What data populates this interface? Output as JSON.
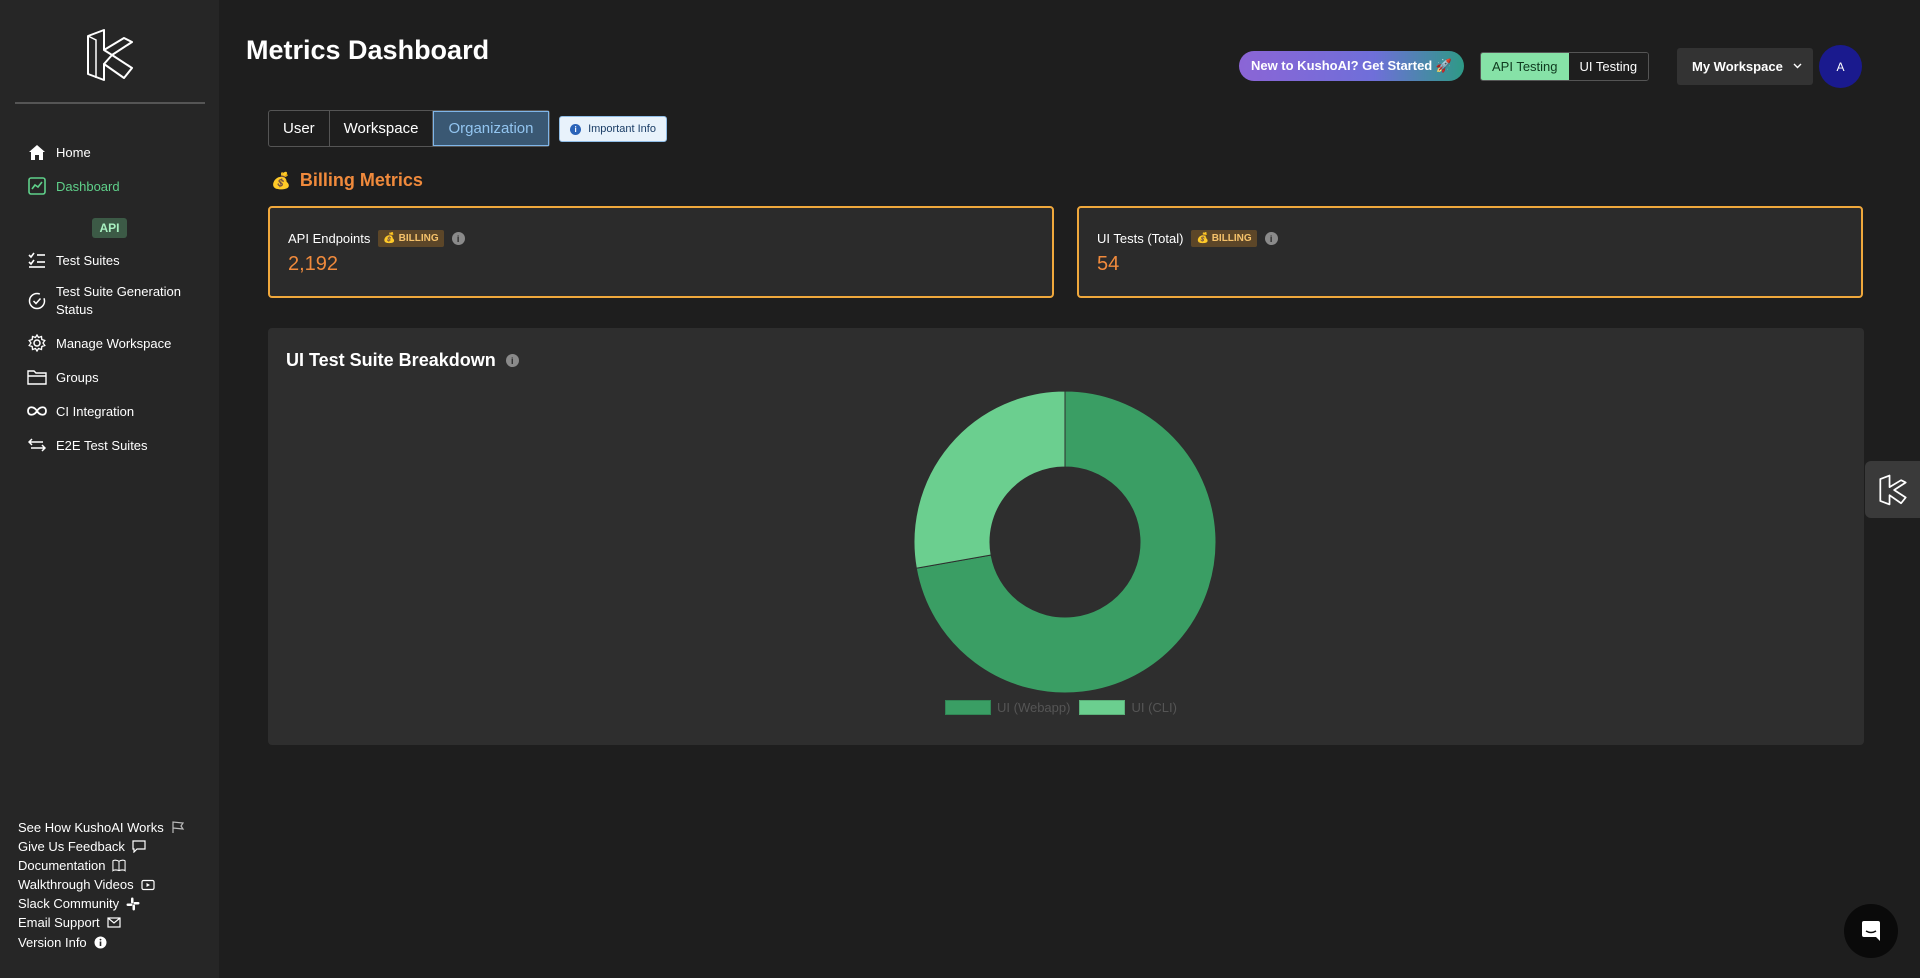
{
  "sidebar": {
    "nav": [
      {
        "label": "Home",
        "icon": "home-icon"
      },
      {
        "label": "Dashboard",
        "icon": "chart-icon",
        "active": true
      },
      {
        "label": "Test Suites",
        "icon": "checklist-icon"
      },
      {
        "label": "Test Suite Generation Status",
        "icon": "check-circle-icon"
      },
      {
        "label": "Manage Workspace",
        "icon": "gear-icon"
      },
      {
        "label": "Groups",
        "icon": "folder-icon"
      },
      {
        "label": "CI Integration",
        "icon": "infinity-icon"
      },
      {
        "label": "E2E Test Suites",
        "icon": "swap-icon"
      }
    ],
    "api_badge": "API",
    "footer": [
      {
        "label": "See How KushoAI Works",
        "icon": "flag-icon"
      },
      {
        "label": "Give Us Feedback",
        "icon": "feedback-icon"
      },
      {
        "label": "Documentation",
        "icon": "book-icon"
      },
      {
        "label": "Walkthrough Videos",
        "icon": "video-icon"
      },
      {
        "label": "Slack Community",
        "icon": "slack-icon"
      },
      {
        "label": "Email Support",
        "icon": "mail-icon"
      },
      {
        "label": "Version Info",
        "icon": "info-icon"
      }
    ]
  },
  "header": {
    "title": "Metrics Dashboard",
    "get_started": "New to KushoAI? Get Started 🚀",
    "mode_api": "API Testing",
    "mode_ui": "UI Testing",
    "workspace": "My Workspace",
    "avatar": "A"
  },
  "tabs": [
    "User",
    "Workspace",
    "Organization"
  ],
  "active_tab": "Organization",
  "important_info": "Important Info",
  "billing": {
    "title": "Billing Metrics",
    "tag": "BILLING",
    "cards": [
      {
        "label": "API Endpoints",
        "value": "2,192"
      },
      {
        "label": "UI Tests (Total)",
        "value": "54"
      }
    ]
  },
  "chart_data": {
    "type": "pie",
    "title": "UI Test Suite Breakdown",
    "categories": [
      "UI (Webapp)",
      "UI (CLI)"
    ],
    "values": [
      39,
      15
    ],
    "colors": [
      "#3a9e64",
      "#6bcf8f"
    ],
    "legend": "bottom"
  },
  "colors": {
    "accent_orange": "#f08a3c",
    "accent_green": "#5fd08a",
    "billing_border": "#f0a83c"
  }
}
